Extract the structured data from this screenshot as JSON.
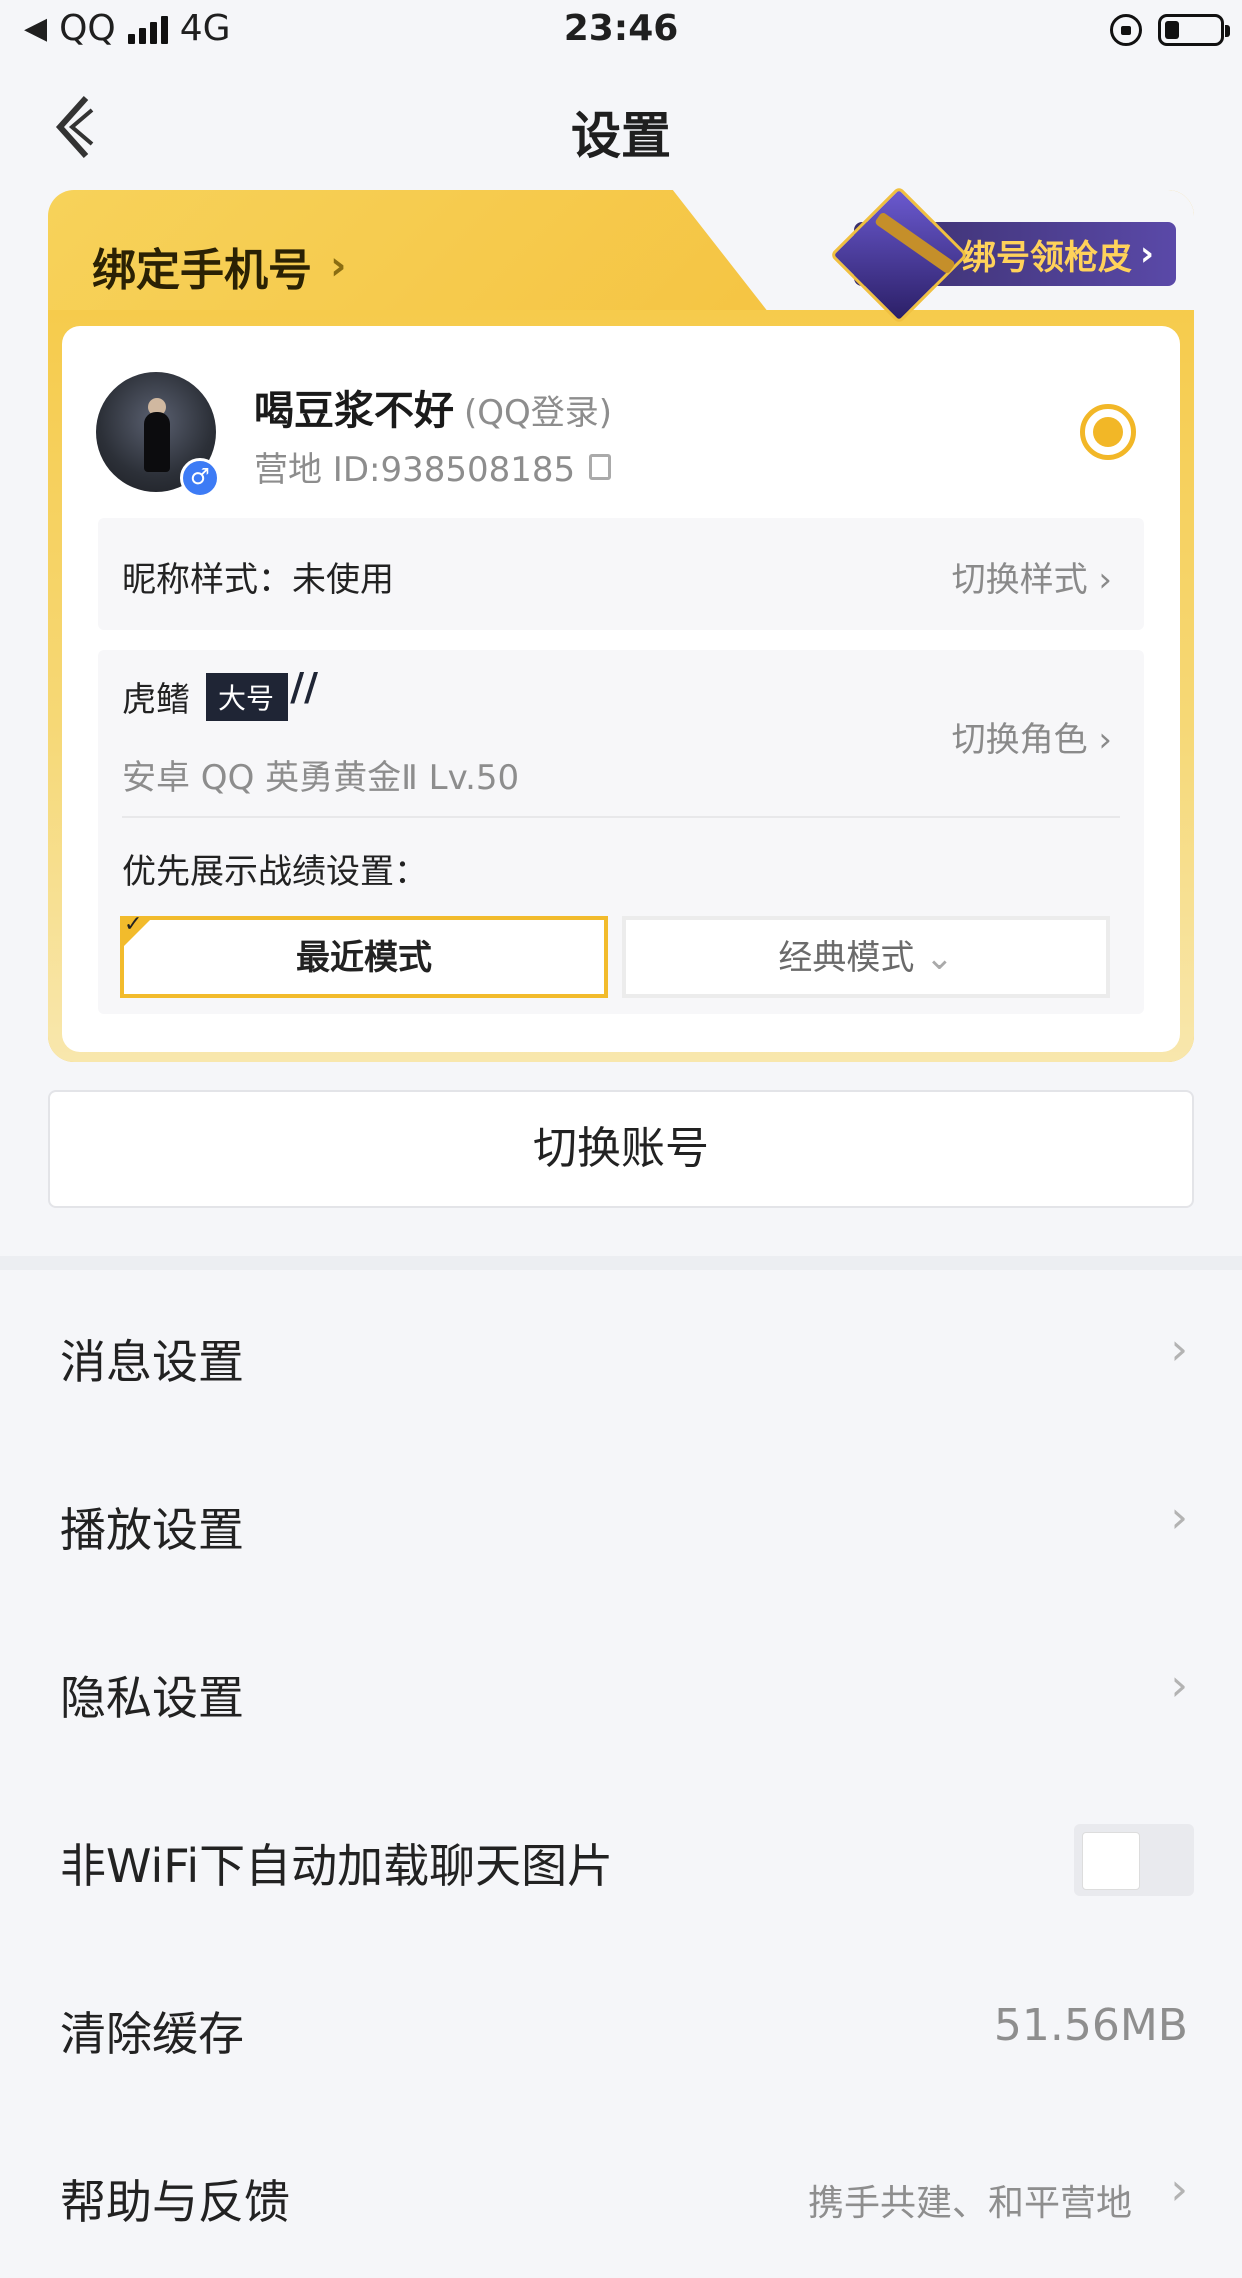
{
  "status_bar": {
    "carrier": "QQ",
    "network": "4G",
    "time": "23:46"
  },
  "nav": {
    "title": "设置"
  },
  "bind_card": {
    "bind_phone": "绑定手机号",
    "promo": "绑号领枪皮",
    "user": {
      "name": "喝豆浆不好",
      "login_type": "(QQ登录)",
      "camp_id": "营地 ID:938508185"
    },
    "nickname_style": "昵称样式：未使用",
    "switch_style": "切换样式",
    "role": {
      "name": "虎鳍",
      "tag": "大号",
      "info": "安卓 QQ  英勇黄金Ⅱ  Lv.50",
      "switch_role": "切换角色"
    },
    "priority_label": "优先展示战绩设置：",
    "modes": {
      "recent": "最近模式",
      "classic": "经典模式"
    }
  },
  "switch_account": "切换账号",
  "menu": [
    {
      "label": "消息设置"
    },
    {
      "label": "播放设置"
    },
    {
      "label": "隐私设置"
    },
    {
      "label": "非WiFi下自动加载聊天图片",
      "toggle": false
    },
    {
      "label": "清除缓存",
      "value": "51.56MB"
    },
    {
      "label": "帮助与反馈",
      "value": "携手共建、和平营地"
    }
  ],
  "colors": {
    "accent": "#f2b727",
    "bg": "#f5f6f9"
  }
}
